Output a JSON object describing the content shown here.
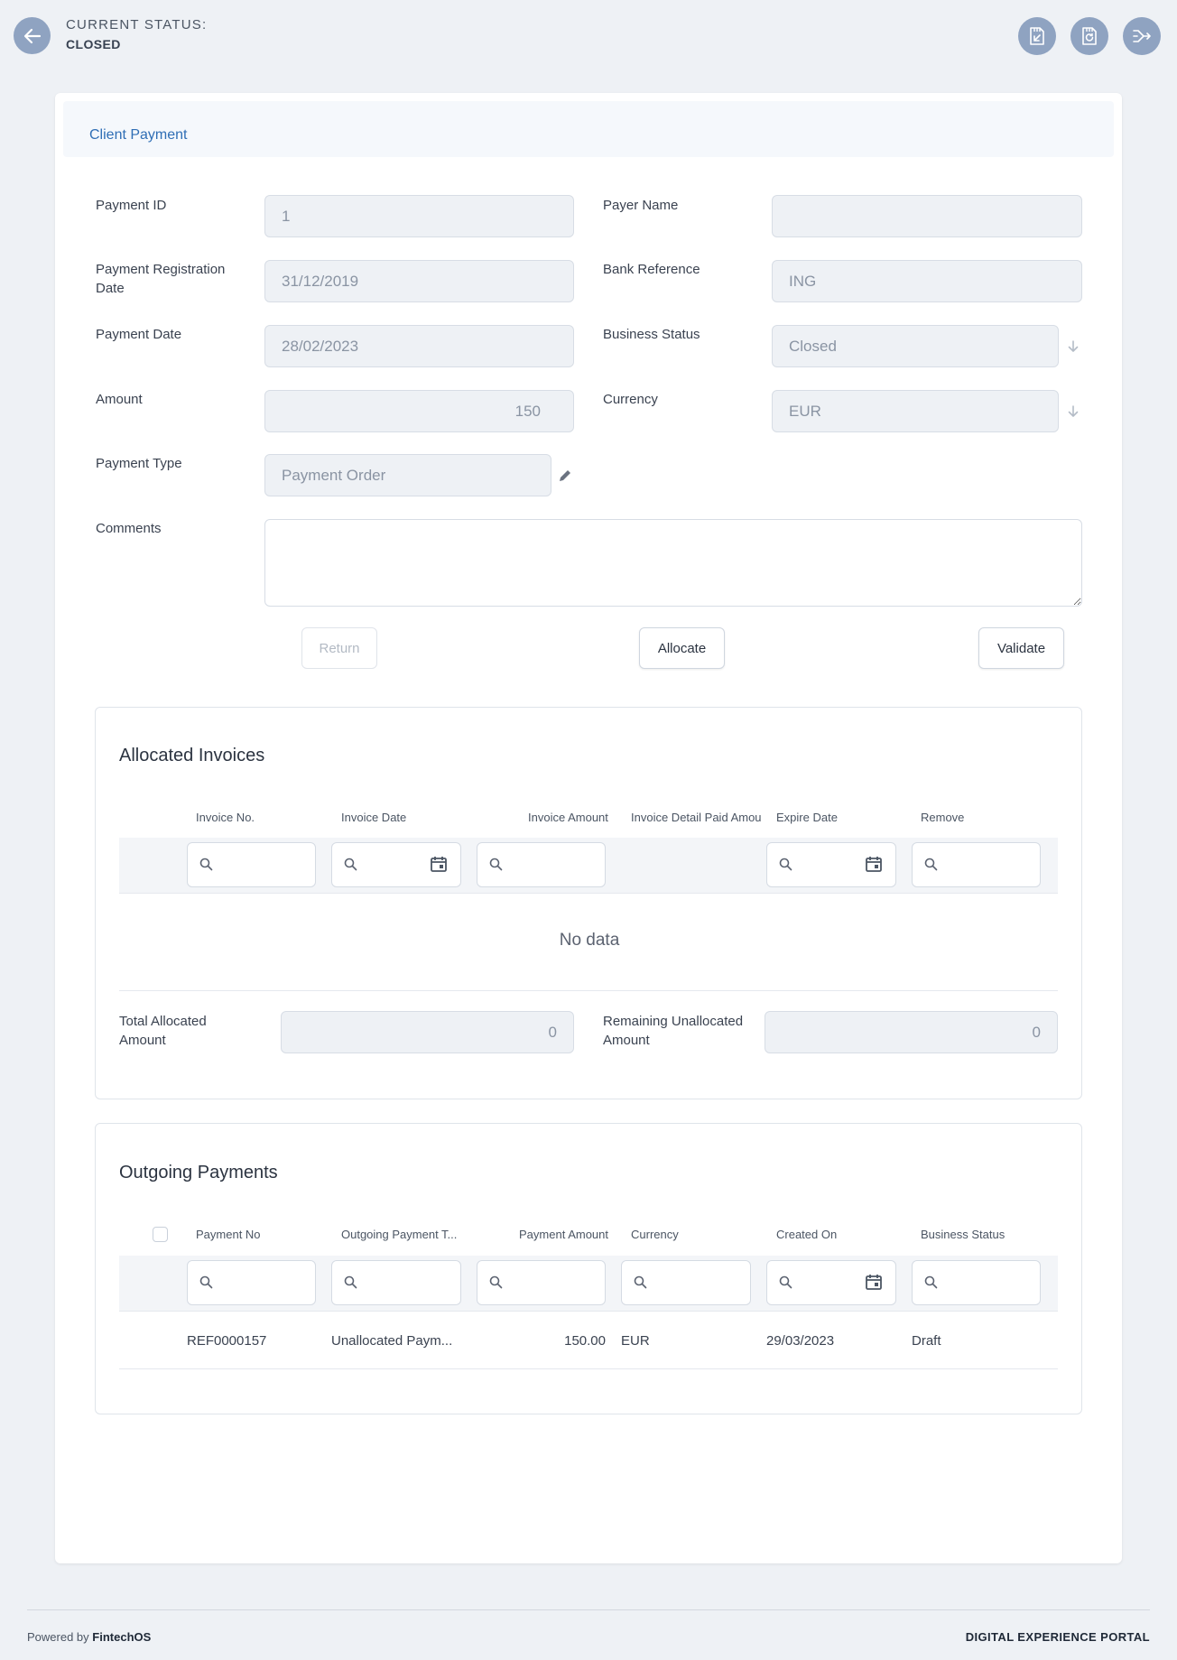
{
  "header": {
    "status_label": "CURRENT STATUS:",
    "status_value": "CLOSED"
  },
  "form": {
    "title": "Client Payment",
    "fields": {
      "payment_id": {
        "label": "Payment ID",
        "value": "1"
      },
      "payer_name": {
        "label": "Payer Name",
        "value": ""
      },
      "registration_date": {
        "label": "Payment Registration Date",
        "value": "31/12/2019"
      },
      "bank_reference": {
        "label": "Bank Reference",
        "value": "ING"
      },
      "payment_date": {
        "label": "Payment Date",
        "value": "28/02/2023"
      },
      "business_status": {
        "label": "Business Status",
        "value": "Closed"
      },
      "amount": {
        "label": "Amount",
        "value": "150"
      },
      "currency": {
        "label": "Currency",
        "value": "EUR"
      },
      "payment_type": {
        "label": "Payment Type",
        "value": "Payment Order"
      },
      "comments": {
        "label": "Comments",
        "value": ""
      }
    },
    "buttons": {
      "return": "Return",
      "allocate": "Allocate",
      "validate": "Validate"
    }
  },
  "allocated_invoices": {
    "title": "Allocated Invoices",
    "columns": [
      "Invoice No.",
      "Invoice Date",
      "Invoice Amount",
      "Invoice Detail Paid Amou",
      "Expire Date",
      "Remove"
    ],
    "empty_text": "No data",
    "total_allocated": {
      "label": "Total Allocated Amount",
      "value": "0"
    },
    "remaining_unallocated": {
      "label": "Remaining Unallocated Amount",
      "value": "0"
    }
  },
  "outgoing_payments": {
    "title": "Outgoing Payments",
    "columns": [
      "Payment No",
      "Outgoing Payment T...",
      "Payment Amount",
      "Currency",
      "Created On",
      "Business Status"
    ],
    "rows": [
      {
        "payment_no": "REF0000157",
        "type": "Unallocated Paym...",
        "amount": "150.00",
        "currency": "EUR",
        "created_on": "29/03/2023",
        "status": "Draft"
      }
    ]
  },
  "footer": {
    "powered_prefix": "Powered by",
    "powered_brand": "FintechOS",
    "portal": "DIGITAL EXPERIENCE PORTAL"
  },
  "colors": {
    "page_bg": "#eef1f5",
    "accent": "#2f6eb5",
    "icon_button": "#8fa3c1"
  },
  "icons": {
    "back": "arrow-left-icon",
    "action_1": "save-import-icon",
    "action_2": "save-refresh-icon",
    "action_3": "merge-arrows-icon",
    "edit": "pencil-icon",
    "dropdown": "arrow-down-icon",
    "search": "search-icon",
    "calendar": "calendar-icon"
  }
}
